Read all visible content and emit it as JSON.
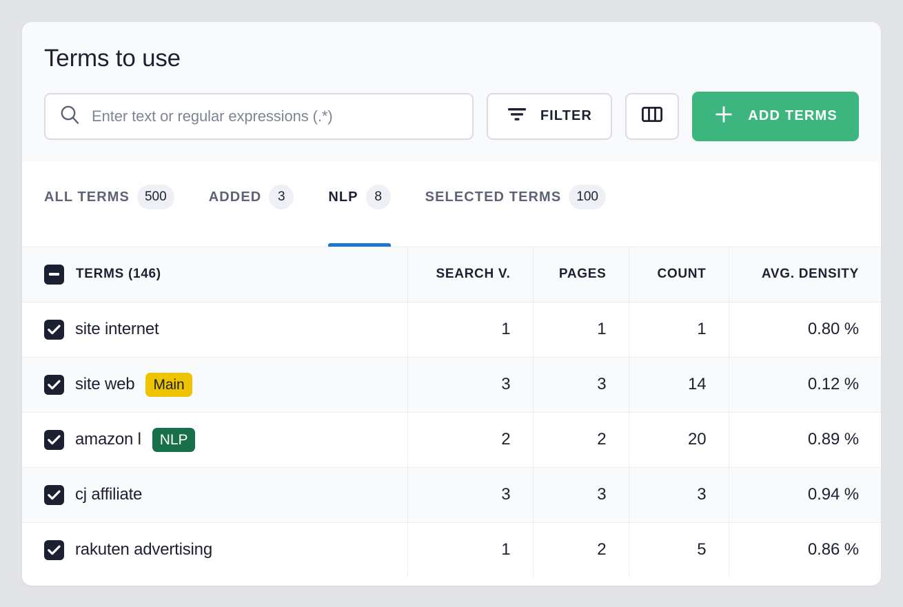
{
  "page": {
    "title": "Terms to use",
    "accent_green": "#3cb57f",
    "accent_blue": "#1a78d2",
    "badge_main_color": "#eec400",
    "badge_nlp_color": "#17704a"
  },
  "search": {
    "placeholder": "Enter text or regular expressions (.*)",
    "value": "",
    "icon": "search-icon"
  },
  "toolbar": {
    "filter_label": "FILTER",
    "filter_icon": "filter-icon",
    "columns_icon": "columns-icon",
    "add_terms_label": "ADD TERMS",
    "add_terms_icon": "plus-icon"
  },
  "tabs": [
    {
      "label": "ALL TERMS",
      "count": "500",
      "active": false
    },
    {
      "label": "ADDED",
      "count": "3",
      "active": false
    },
    {
      "label": "NLP",
      "count": "8",
      "active": true
    },
    {
      "label": "SELECTED TERMS",
      "count": "100",
      "active": false
    }
  ],
  "table": {
    "headers": {
      "terms": "TERMS (146)",
      "search_volume": "SEARCH V.",
      "pages": "PAGES",
      "count": "COUNT",
      "density": "AVG. DENSITY"
    },
    "select_all_state": "indeterminate",
    "rows": [
      {
        "term": "site internet",
        "badge": "",
        "badge_type": "",
        "search_volume": "1",
        "pages": "1",
        "count": "1",
        "density": "0.80 %",
        "checked": true
      },
      {
        "term": "site web",
        "badge": "Main",
        "badge_type": "main",
        "search_volume": "3",
        "pages": "3",
        "count": "14",
        "density": "0.12 %",
        "checked": true
      },
      {
        "term": "amazon l",
        "badge": "NLP",
        "badge_type": "nlp",
        "search_volume": "2",
        "pages": "2",
        "count": "20",
        "density": "0.89 %",
        "checked": true
      },
      {
        "term": "cj affiliate",
        "badge": "",
        "badge_type": "",
        "search_volume": "3",
        "pages": "3",
        "count": "3",
        "density": "0.94 %",
        "checked": true
      },
      {
        "term": "rakuten advertising",
        "badge": "",
        "badge_type": "",
        "search_volume": "1",
        "pages": "2",
        "count": "5",
        "density": "0.86 %",
        "checked": true
      }
    ]
  }
}
